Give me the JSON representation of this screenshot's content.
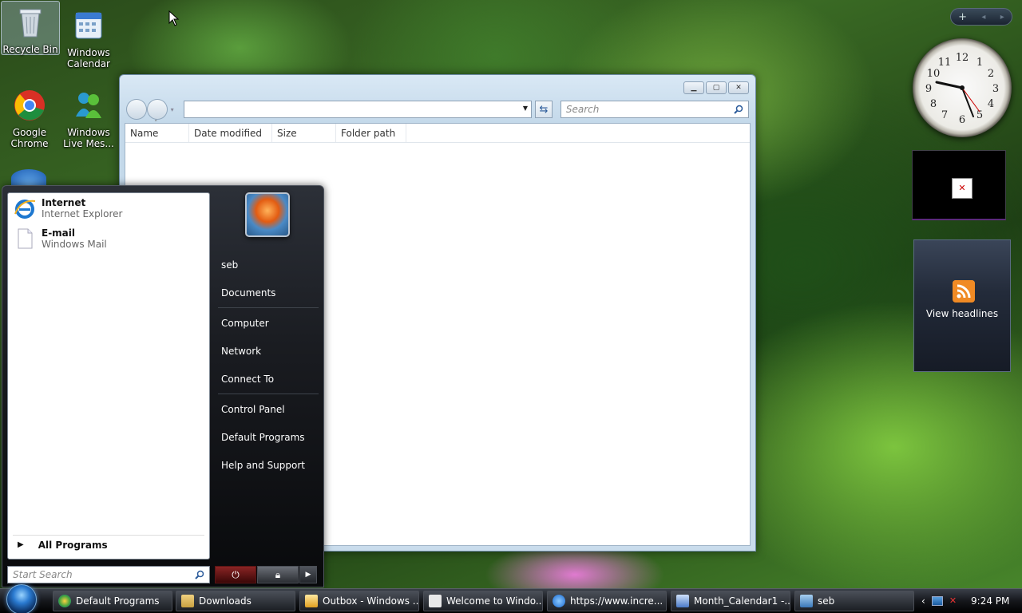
{
  "desktop": {
    "icons": [
      {
        "label": "Recycle Bin",
        "icon": "recycle-bin-icon"
      },
      {
        "label": "Windows Calendar",
        "icon": "calendar-icon"
      },
      {
        "label": "Google Chrome",
        "icon": "chrome-icon"
      },
      {
        "label": "Windows Live Mes...",
        "icon": "messenger-icon"
      }
    ]
  },
  "explorer": {
    "address_value": "",
    "search_placeholder": "Search",
    "columns": [
      "Name",
      "Date modified",
      "Size",
      "Folder path"
    ]
  },
  "start_menu": {
    "pinned": [
      {
        "title": "Internet",
        "subtitle": "Internet Explorer",
        "icon": "internet-explorer-icon"
      },
      {
        "title": "E-mail",
        "subtitle": "Windows Mail",
        "icon": "mail-icon"
      }
    ],
    "all_programs": "All Programs",
    "search_placeholder": "Start Search",
    "right_items": {
      "user": "seb",
      "documents": "Documents",
      "computer": "Computer",
      "network": "Network",
      "connect_to": "Connect To",
      "control_panel": "Control Panel",
      "default_programs": "Default Programs",
      "help": "Help and Support"
    }
  },
  "gadgets": {
    "clock_time": "9:24",
    "feed_label": "View headlines"
  },
  "taskbar": {
    "buttons": [
      {
        "label": "Default Programs",
        "icon": "default-programs-icon"
      },
      {
        "label": "Downloads",
        "icon": "folder-icon"
      },
      {
        "label": "Outbox - Windows ...",
        "icon": "mail-icon"
      },
      {
        "label": "Welcome to Windo...",
        "icon": "envelope-icon"
      },
      {
        "label": "https://www.incre...",
        "icon": "internet-explorer-icon"
      },
      {
        "label": "Month_Calendar1 -...",
        "icon": "document-icon"
      },
      {
        "label": "seb",
        "icon": "folder-icon"
      }
    ],
    "time": "9:24 PM"
  }
}
